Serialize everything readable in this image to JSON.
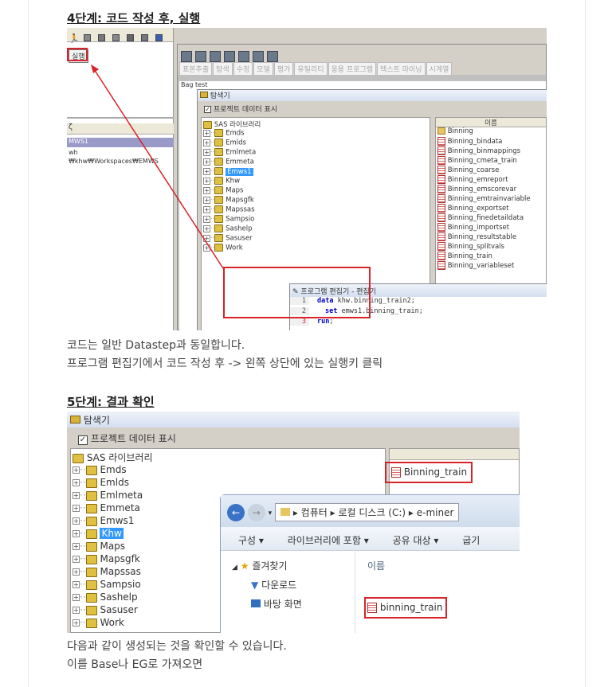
{
  "step4": {
    "heading": "4단계: 코드 작성 후, 실행",
    "run_button": "실행",
    "left_panel": {
      "col_header": "ζ",
      "row_selected": "MWS1",
      "row2": "wh",
      "path": "₩khw₩Workspaces₩EMWS"
    },
    "tabs": [
      "표본추출",
      "탐색",
      "수정",
      "모델",
      "평가",
      "유틸리티",
      "응용 프로그램",
      "텍스트 마이닝",
      "시계열"
    ],
    "window_title": "test",
    "explorer": {
      "title": "탐색기",
      "show_project_label": "프로젝트 데이터 표시",
      "root": "SAS 라이브러리",
      "libraries": [
        "Emds",
        "Emlds",
        "Emlmeta",
        "Emmeta",
        "Emws1",
        "Khw",
        "Maps",
        "Mapsgfk",
        "Mapssas",
        "Sampsio",
        "Sashelp",
        "Sasuser",
        "Work"
      ],
      "selected_library": "Emws1",
      "name_header": "이름",
      "datasets": [
        "Binning",
        "Binning_bindata",
        "Binning_binmappings",
        "Binning_cmeta_train",
        "Binning_coarse",
        "Binning_emreport",
        "Binning_emscorevar",
        "Binning_emtrainvariable",
        "Binning_exportset",
        "Binning_finedetaildata",
        "Binning_importset",
        "Binning_resultstable",
        "Binning_splitvals",
        "Binning_train",
        "Binning_variableset"
      ]
    },
    "editor": {
      "title": "프로그램 편집기 - 편집기",
      "lines": [
        {
          "num": "1",
          "kw": "data",
          "rest": " khw.binning_train2;"
        },
        {
          "num": "2",
          "kw": "set",
          "rest": " emws1.binning_train;"
        },
        {
          "num": "3",
          "kw": "run",
          "rest": ";"
        }
      ]
    }
  },
  "text1": {
    "line1": "코드는 일반 Datastep과 동일합니다.",
    "line2": "프로그램 편집기에서 코드 작성 후 -> 왼쪽 상단에 있는 실행키 클릭"
  },
  "step5": {
    "heading": "5단계: 결과 확인",
    "explorer": {
      "title": "탐색기",
      "show_project_label": "프로젝트 데이터 표시",
      "root": "SAS 라이브러리",
      "libraries": [
        "Emds",
        "Emlds",
        "Emlmeta",
        "Emmeta",
        "Emws1",
        "Khw",
        "Maps",
        "Mapsgfk",
        "Mapssas",
        "Sampsio",
        "Sashelp",
        "Sasuser",
        "Work"
      ],
      "selected_library": "Khw",
      "result_item": "Binning_train"
    },
    "file_explorer": {
      "breadcrumb": [
        "컴퓨터",
        "로컬 디스크 (C:)",
        "e-miner"
      ],
      "toolbar": [
        "구성 ▾",
        "라이브러리에 포함 ▾",
        "공유 대상 ▾",
        "굽기"
      ],
      "nav": [
        "즐겨찾기",
        "다운로드",
        "바탕 화면"
      ],
      "col_name": "이름",
      "file": "binning_train"
    }
  },
  "text2": {
    "line1": "다음과 같이 생성되는 것을 확인할 수 있습니다.",
    "line2": "이를 Base나 EG로 가져오면"
  }
}
